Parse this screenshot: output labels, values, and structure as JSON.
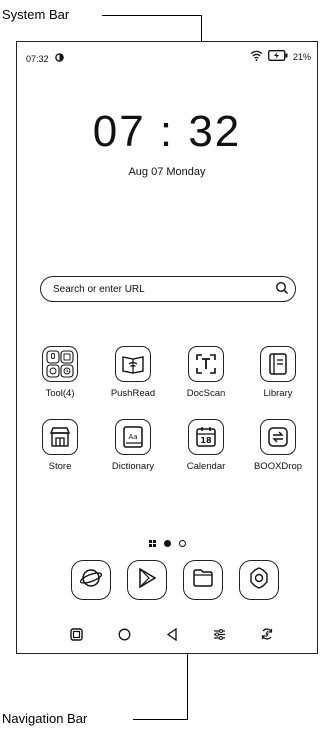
{
  "annotations": {
    "top": "System Bar",
    "bottom": "Navigation Bar"
  },
  "status_bar": {
    "time": "07:32",
    "battery": "21%",
    "icons": [
      "sync-icon",
      "wifi-icon",
      "battery-charging-icon"
    ]
  },
  "clock": {
    "time": "07 : 32",
    "date": "Aug 07 Monday"
  },
  "search": {
    "placeholder": "Search or enter URL",
    "icon": "search-icon"
  },
  "apps": [
    {
      "label": "Tool(4)",
      "icon": "tools-folder-icon"
    },
    {
      "label": "PushRead",
      "icon": "pushread-icon"
    },
    {
      "label": "DocScan",
      "icon": "docscan-icon"
    },
    {
      "label": "Library",
      "icon": "library-icon"
    },
    {
      "label": "Store",
      "icon": "store-icon"
    },
    {
      "label": "Dictionary",
      "icon": "dictionary-icon"
    },
    {
      "label": "Calendar",
      "icon": "calendar-icon",
      "badge": "18"
    },
    {
      "label": "BOOXDrop",
      "icon": "booxdrop-icon"
    }
  ],
  "pager": {
    "pages": 2,
    "current": 1,
    "icon": "app-grid-icon"
  },
  "dock": [
    "browser-icon",
    "play-store-icon",
    "files-icon",
    "settings-icon"
  ],
  "nav_bar": [
    "multitask-icon",
    "home-icon",
    "back-icon",
    "adjust-icon",
    "refresh-icon"
  ]
}
